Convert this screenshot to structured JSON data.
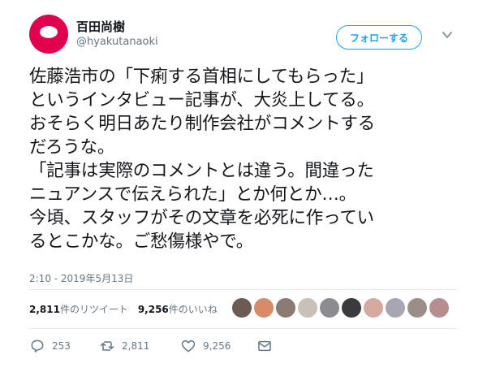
{
  "user": {
    "display_name": "百田尚樹",
    "handle": "@hyakutanaoki",
    "follow_label": "フォローする",
    "avatar_color": "#e0004d"
  },
  "tweet": {
    "lines": [
      "佐藤浩市の「下痢する首相にしてもらった」",
      "というインタビュー記事が、大炎上してる。",
      "おそらく明日あたり制作会社がコメントする",
      "だろうな。",
      "「記事は実際のコメントとは違う。間違った",
      "ニュアンスで伝えられた」とか何とか…。",
      "今頃、スタッフがその文章を必死に作ってい",
      "るとこかな。ご愁傷様やで。"
    ],
    "timestamp": "2:10 - 2019年5月13日"
  },
  "stats": {
    "retweets_count": "2,811",
    "retweets_label": "件のリツイート",
    "likes_count": "9,256",
    "likes_label": "件のいいね"
  },
  "liker_colors": [
    "#6b5b52",
    "#d98a66",
    "#8a7a70",
    "#c9c0b8",
    "#8b8c90",
    "#3a3a3f",
    "#d4a9a0",
    "#a9a6b3",
    "#9b8e86",
    "#b58f90"
  ],
  "actions": {
    "reply_count": "253",
    "retweet_count": "2,811",
    "like_count": "9,256"
  },
  "icons": [
    "reply-icon",
    "retweet-icon",
    "heart-icon",
    "dm-icon",
    "chevron-down-icon"
  ]
}
